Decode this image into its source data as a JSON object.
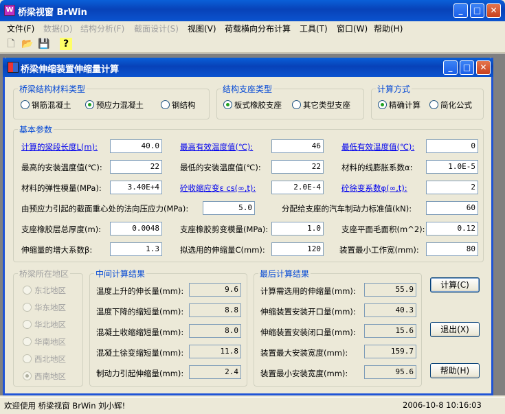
{
  "app": {
    "title": "桥梁视窗 BrWin"
  },
  "menu": [
    "文件(F)",
    "数据(D)",
    "结构分析(F)",
    "截面设计(S)",
    "视图(V)",
    "荷载横向分布计算",
    "工具(T)",
    "窗口(W)",
    "帮助(H)"
  ],
  "menu_disabled": [
    false,
    true,
    true,
    true,
    false,
    false,
    false,
    false,
    false
  ],
  "toolbar": {
    "icons": [
      "new-file-icon",
      "open-folder-icon",
      "save-icon",
      "help-icon"
    ]
  },
  "dialog": {
    "title": "桥梁伸缩装置伸缩量计算",
    "material": {
      "title": "桥梁结构材料类型",
      "options": [
        "钢筋混凝土",
        "预应力混凝土",
        "钢结构"
      ],
      "selected": 1
    },
    "support": {
      "title": "结构支座类型",
      "options": [
        "板式橡胶支座",
        "其它类型支座"
      ],
      "selected": 0
    },
    "method": {
      "title": "计算方式",
      "options": [
        "精确计算",
        "简化公式"
      ],
      "selected": 0
    },
    "params": {
      "title": "基本参数",
      "r1": [
        {
          "label": "计算的梁段长度L(m):",
          "value": "40.0",
          "link": true
        },
        {
          "label": "最高有效温度值(℃):",
          "value": "46",
          "link": true
        },
        {
          "label": "最低有效温度值(℃):",
          "value": "0",
          "link": true
        }
      ],
      "r2": [
        {
          "label": "最高的安装温度值(℃):",
          "value": "22"
        },
        {
          "label": "最低的安装温度值(℃):",
          "value": "22"
        },
        {
          "label": "材料的线膨胀系数α:",
          "value": "1.0E-5"
        }
      ],
      "r3": [
        {
          "label": "材料的弹性模量(MPa):",
          "value": "3.40E+4"
        },
        {
          "label": "砼收缩应变ε cs(∞,t):",
          "value": "2.0E-4",
          "link": true
        },
        {
          "label": "砼徐变系数φ(∞,t):",
          "value": "2",
          "link": true
        }
      ],
      "r4": [
        {
          "label": "由预应力引起的截面重心处的法向压应力(MPa):",
          "value": "5.0"
        },
        {
          "label": "分配给支座的汽车制动力标准值(kN):",
          "value": "60"
        }
      ],
      "r5": [
        {
          "label": "支座橡胶层总厚度(m):",
          "value": "0.0048"
        },
        {
          "label": "支座橡胶剪变模量(MPa):",
          "value": "1.0"
        },
        {
          "label": "支座平面毛面积(m^2):",
          "value": "0.12"
        }
      ],
      "r6": [
        {
          "label": "伸缩量的增大系数β:",
          "value": "1.3"
        },
        {
          "label": "拟选用的伸缩量C(mm):",
          "value": "120"
        },
        {
          "label": "装置最小工作宽(mm):",
          "value": "80"
        }
      ]
    },
    "region": {
      "title": "桥梁所在地区",
      "options": [
        "东北地区",
        "华东地区",
        "华北地区",
        "华南地区",
        "西北地区",
        "西南地区"
      ],
      "selected": 5
    },
    "intermediate": {
      "title": "中间计算结果",
      "rows": [
        {
          "label": "温度上升的伸长量(mm):",
          "value": "9.6"
        },
        {
          "label": "温度下降的缩短量(mm):",
          "value": "8.8"
        },
        {
          "label": "混凝土收缩缩短量(mm):",
          "value": "8.0"
        },
        {
          "label": "混凝土徐变缩短量(mm):",
          "value": "11.8"
        },
        {
          "label": "制动力引起伸缩量(mm):",
          "value": "2.4"
        }
      ]
    },
    "final": {
      "title": "最后计算结果",
      "rows": [
        {
          "label": "计算需选用的伸缩量(mm):",
          "value": "55.9"
        },
        {
          "label": "伸缩装置安装开口量(mm):",
          "value": "40.3"
        },
        {
          "label": "伸缩装置安装闭口量(mm):",
          "value": "15.6"
        },
        {
          "label": "装置最大安装宽度(mm):",
          "value": "159.7"
        },
        {
          "label": "装置最小安装宽度(mm):",
          "value": "95.6"
        }
      ]
    },
    "buttons": {
      "calc": "计算(C)",
      "exit": "退出(X)",
      "help": "帮助(H)"
    }
  },
  "status": {
    "welcome": "欢迎使用 桥梁视窗 BrWin  刘小辉!",
    "datetime": "2006-10-8  10:16:03"
  }
}
